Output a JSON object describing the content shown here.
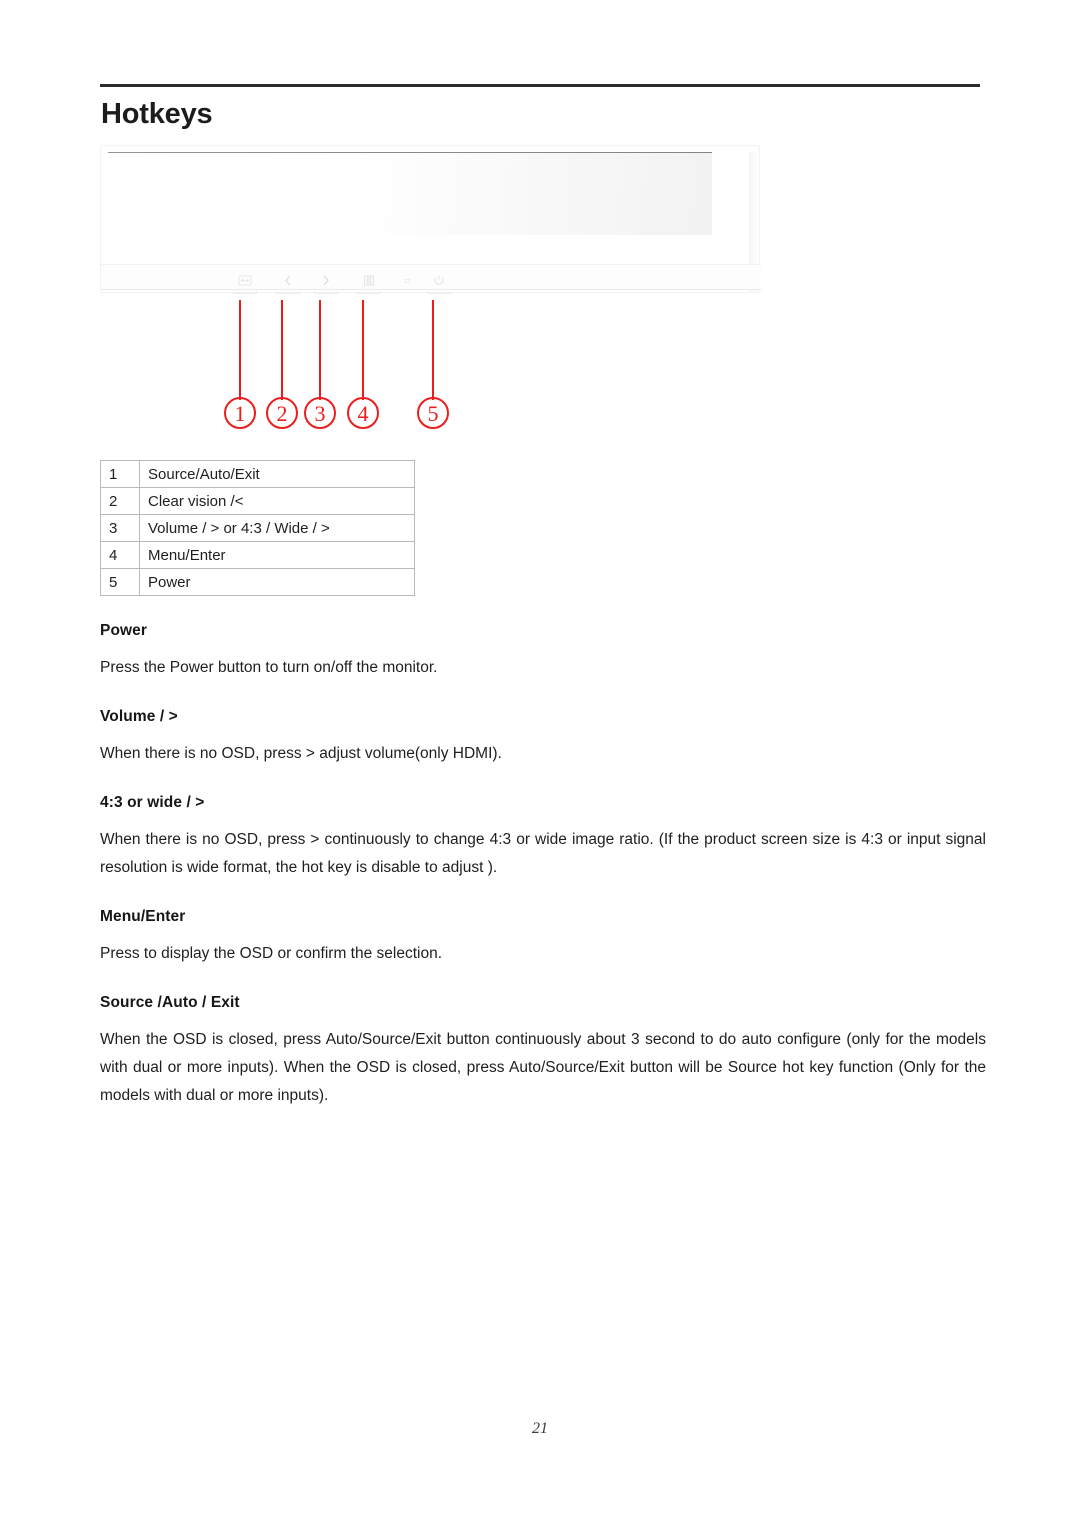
{
  "document": {
    "title": "Hotkeys",
    "page_number": "21"
  },
  "figure": {
    "name": "monitor-front-bezel-controls",
    "controls": [
      {
        "icon": "source-auto-exit-icon",
        "glyph": "source"
      },
      {
        "icon": "left-arrow-icon",
        "glyph": "<"
      },
      {
        "icon": "right-arrow-icon",
        "glyph": ">"
      },
      {
        "icon": "menu-icon",
        "glyph": "menu"
      },
      {
        "icon": "power-led-indicator",
        "glyph": "led"
      },
      {
        "icon": "power-icon",
        "glyph": "power"
      }
    ],
    "callouts": [
      {
        "number": "1"
      },
      {
        "number": "2"
      },
      {
        "number": "3"
      },
      {
        "number": "4"
      },
      {
        "number": "5"
      }
    ]
  },
  "table": {
    "rows": [
      {
        "index": "1",
        "description": "Source/Auto/Exit"
      },
      {
        "index": "2",
        "description": "Clear vision /<"
      },
      {
        "index": "3",
        "description": "Volume / > or 4:3 / Wide / >"
      },
      {
        "index": "4",
        "description": "Menu/Enter"
      },
      {
        "index": "5",
        "description": "Power"
      }
    ]
  },
  "sections": [
    {
      "heading": "Power",
      "body": "Press the Power button to turn on/off the monitor."
    },
    {
      "heading": "Volume / >",
      "body": "When there is no OSD, press > adjust volume(only HDMI)."
    },
    {
      "heading": "4:3 or wide / >",
      "body": "When there is no OSD, press > continuously to change 4:3 or wide image ratio. (If the product screen size is 4:3 or input signal resolution is wide format, the hot key is disable to adjust )."
    },
    {
      "heading": "Menu/Enter",
      "body": "Press to display the OSD or confirm the selection."
    },
    {
      "heading": "Source /Auto / Exit",
      "body": "When the OSD is closed, press Auto/Source/Exit button continuously about 3 second to do auto configure (only for the models with dual or more inputs). When the OSD is closed, press Auto/Source/Exit button will be Source hot key function (Only for the models with dual or more inputs)."
    }
  ],
  "colors": {
    "callout_red": "#ee1c1c",
    "rule_dark": "#2b2b2b",
    "table_border": "#b9b9b9"
  }
}
